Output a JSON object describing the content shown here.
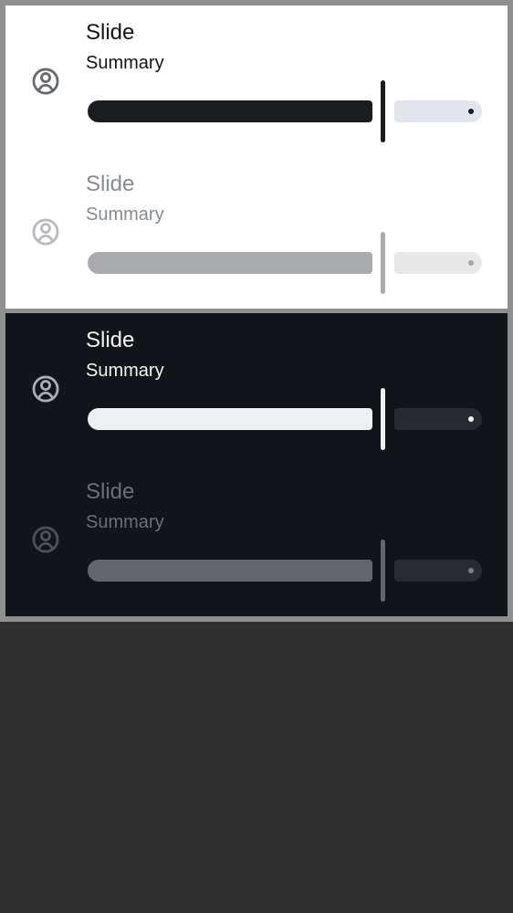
{
  "light_panel": {
    "enabled_item": {
      "icon": "account-circle-icon",
      "title": "Slide",
      "summary": "Summary",
      "slider_value_fraction": 0.76
    },
    "disabled_item": {
      "icon": "account-circle-icon",
      "title": "Slide",
      "summary": "Summary",
      "slider_value_fraction": 0.76
    }
  },
  "dark_panel": {
    "enabled_item": {
      "icon": "account-circle-icon",
      "title": "Slide",
      "summary": "Summary",
      "slider_value_fraction": 0.76
    },
    "disabled_item": {
      "icon": "account-circle-icon",
      "title": "Slide",
      "summary": "Summary",
      "slider_value_fraction": 0.76
    }
  },
  "colors": {
    "outer_background": "#303030",
    "frame_border": "#8f8f8f",
    "light_panel_background": "#ffffff",
    "dark_panel_background": "#111419",
    "light_active_track": "#1b1c20",
    "light_inactive_track": "#e2e6ec",
    "dark_active_track": "#eef1f4",
    "dark_inactive_track": "#272a30"
  }
}
